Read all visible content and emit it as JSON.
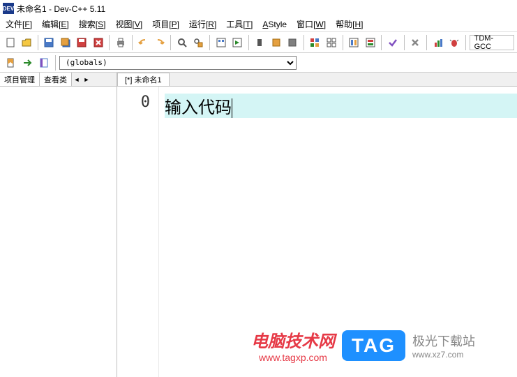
{
  "titlebar": {
    "app_icon_text": "DEV",
    "title": "未命名1 - Dev-C++ 5.11"
  },
  "menubar": {
    "items": [
      {
        "label": "文件",
        "key": "F"
      },
      {
        "label": "编辑",
        "key": "E"
      },
      {
        "label": "搜索",
        "key": "S"
      },
      {
        "label": "视图",
        "key": "V"
      },
      {
        "label": "项目",
        "key": "P"
      },
      {
        "label": "运行",
        "key": "R"
      },
      {
        "label": "工具",
        "key": "T"
      },
      {
        "label": "AStyle",
        "key": ""
      },
      {
        "label": "窗口",
        "key": "W"
      },
      {
        "label": "帮助",
        "key": "H"
      }
    ]
  },
  "toolbar2": {
    "globals_value": "(globals)"
  },
  "sidebar": {
    "tab1": "项目管理",
    "tab2": "查看类"
  },
  "editor": {
    "tab_name": "[*] 未命名1",
    "line_number": "0",
    "code_text": "输入代码"
  },
  "compiler_button": "TDM-GCC",
  "watermark": {
    "left_title": "电脑技术网",
    "left_url": "www.tagxp.com",
    "tag": "TAG",
    "right_title": "极光下载站",
    "right_url": "www.xz7.com"
  }
}
